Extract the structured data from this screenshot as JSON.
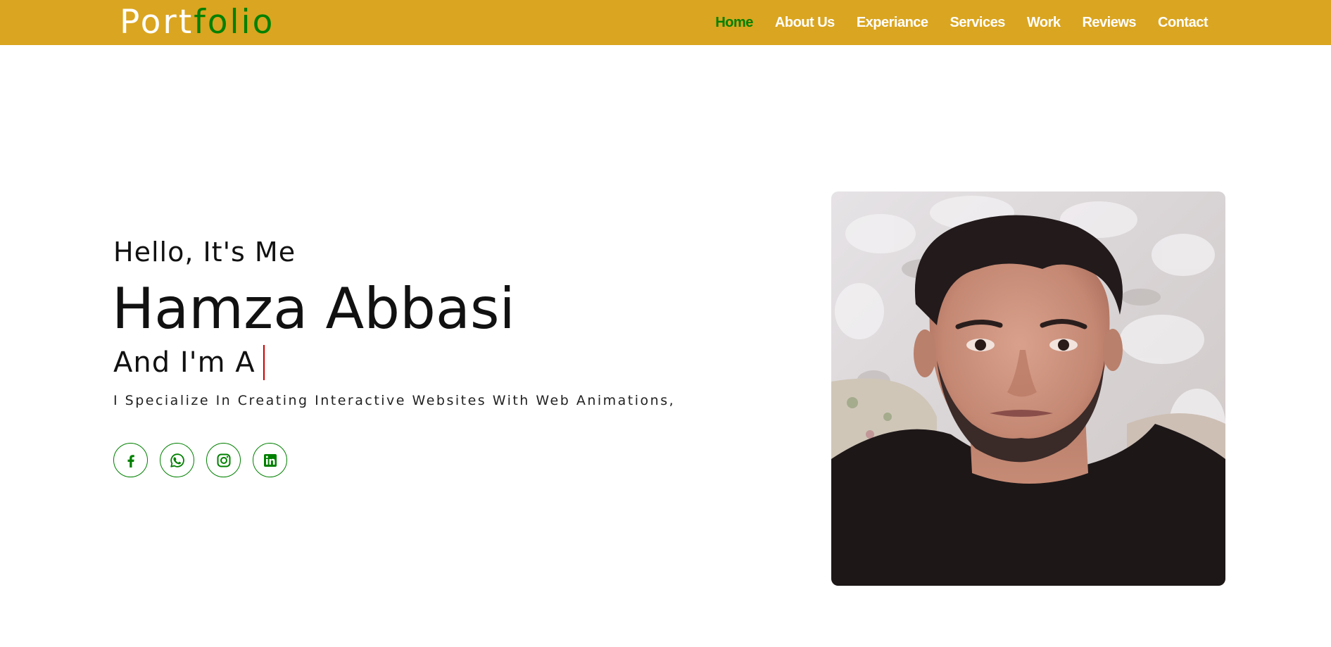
{
  "brand": {
    "logo_part1": "Port",
    "logo_part2": "folio",
    "header_color": "#daa520",
    "accent_color": "#008000"
  },
  "nav": {
    "items": [
      {
        "label": "Home",
        "active": true
      },
      {
        "label": "About Us",
        "active": false
      },
      {
        "label": "Experiance",
        "active": false
      },
      {
        "label": "Services",
        "active": false
      },
      {
        "label": "Work",
        "active": false
      },
      {
        "label": "Reviews",
        "active": false
      },
      {
        "label": "Contact",
        "active": false
      }
    ]
  },
  "hero": {
    "greeting": "Hello, It's Me",
    "name": "Hamza Abbasi",
    "role_prefix": "And I'm A",
    "tagline": "I Specialize In Creating Interactive Websites With Web Animations,"
  },
  "socials": [
    {
      "icon": "facebook-icon"
    },
    {
      "icon": "whatsapp-icon"
    },
    {
      "icon": "instagram-icon"
    },
    {
      "icon": "linkedin-icon"
    }
  ],
  "profile_photo": {
    "icon": "profile-photo"
  }
}
